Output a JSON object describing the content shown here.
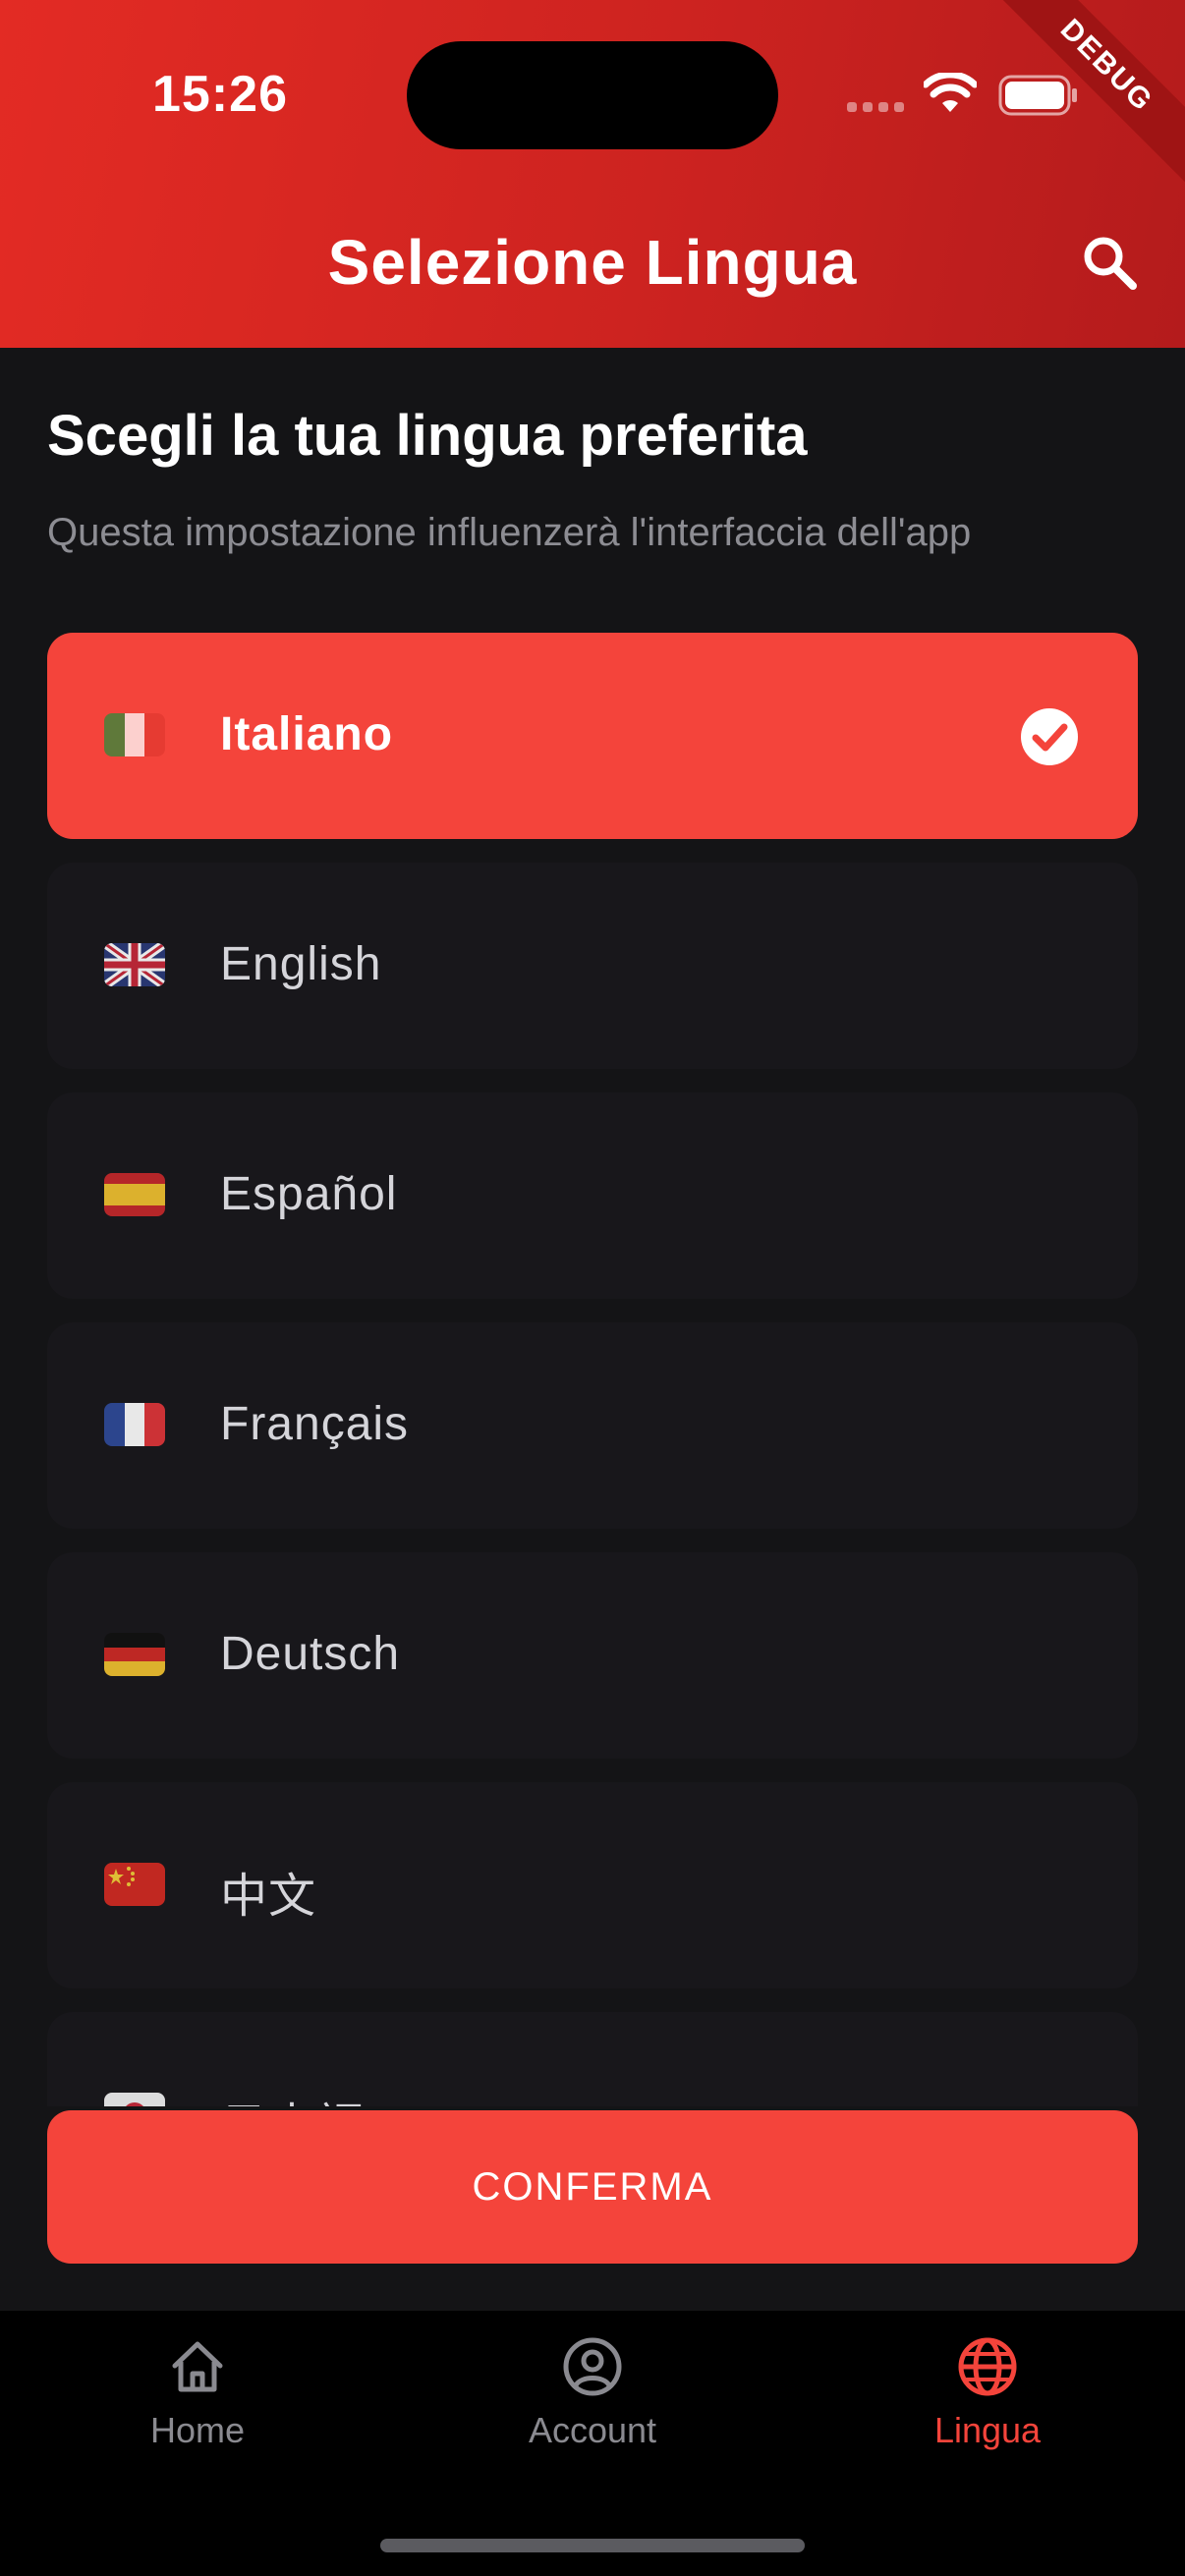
{
  "status_bar": {
    "time": "15:26"
  },
  "debug_banner": "DEBUG",
  "app_bar": {
    "title": "Selezione Lingua",
    "search_icon": "search-icon"
  },
  "heading": "Scegli la tua lingua preferita",
  "subheading": "Questa impostazione influenzerà l'interfaccia dell'app",
  "languages": [
    {
      "label": "Italiano",
      "flag": "italy-flag-icon",
      "selected": true
    },
    {
      "label": "English",
      "flag": "uk-flag-icon",
      "selected": false
    },
    {
      "label": "Español",
      "flag": "spain-flag-icon",
      "selected": false
    },
    {
      "label": "Français",
      "flag": "france-flag-icon",
      "selected": false
    },
    {
      "label": "Deutsch",
      "flag": "germany-flag-icon",
      "selected": false
    },
    {
      "label": "中文",
      "flag": "china-flag-icon",
      "selected": false
    },
    {
      "label": "日本語",
      "flag": "japan-flag-icon",
      "selected": false
    }
  ],
  "confirm_label": "CONFERMA",
  "bottom_nav": [
    {
      "label": "Home",
      "icon": "home-icon",
      "active": false
    },
    {
      "label": "Account",
      "icon": "account-icon",
      "active": false
    },
    {
      "label": "Lingua",
      "icon": "globe-icon",
      "active": true
    }
  ],
  "colors": {
    "accent": "#f4443b",
    "app_bar": "#e32b24",
    "background": "#141416",
    "card": "#18171b",
    "nav_background": "#000000"
  }
}
